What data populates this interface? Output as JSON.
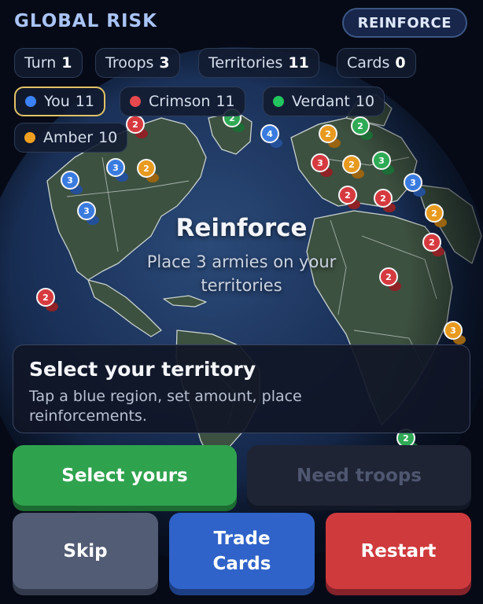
{
  "header": {
    "title": "GLOBAL RISK",
    "phase_button": "REINFORCE"
  },
  "stats": [
    {
      "label": "Turn",
      "value": "1"
    },
    {
      "label": "Troops",
      "value": "3"
    },
    {
      "label": "Territories",
      "value": "11"
    },
    {
      "label": "Cards",
      "value": "0"
    }
  ],
  "players": [
    {
      "name": "You",
      "count": "11",
      "color": "#3b82f6",
      "active": true
    },
    {
      "name": "Crimson",
      "count": "11",
      "color": "#e5484d",
      "active": false
    },
    {
      "name": "Verdant",
      "count": "10",
      "color": "#22c55e",
      "active": false
    },
    {
      "name": "Amber",
      "count": "10",
      "color": "#f0a020",
      "active": false
    }
  ],
  "overlay": {
    "title": "Reinforce",
    "subtitle_line1": "Place 3 armies on your",
    "subtitle_line2": "territories"
  },
  "info": {
    "title": "Select your territory",
    "line1": "Tap a blue region, set amount, place",
    "line2": "reinforcements."
  },
  "buttons": {
    "select": "Select yours",
    "need": "Need troops",
    "skip": "Skip",
    "trade_line1": "Trade",
    "trade_line2": "Cards",
    "restart": "Restart"
  },
  "markers": [
    {
      "owner": "red",
      "label": "2"
    },
    {
      "owner": "green",
      "label": "2"
    },
    {
      "owner": "blue",
      "label": "4"
    },
    {
      "owner": "amber",
      "label": "2"
    },
    {
      "owner": "green",
      "label": "2"
    },
    {
      "owner": "blue",
      "label": "3"
    },
    {
      "owner": "amber",
      "label": "2"
    },
    {
      "owner": "blue",
      "label": "3"
    },
    {
      "owner": "red",
      "label": "3"
    },
    {
      "owner": "amber",
      "label": "2"
    },
    {
      "owner": "green",
      "label": "3"
    },
    {
      "owner": "blue",
      "label": "3"
    },
    {
      "owner": "red",
      "label": "2"
    },
    {
      "owner": "red",
      "label": "2"
    },
    {
      "owner": "amber",
      "label": "2"
    },
    {
      "owner": "red",
      "label": "2"
    },
    {
      "owner": "red",
      "label": "2"
    },
    {
      "owner": "red",
      "label": "2"
    },
    {
      "owner": "amber",
      "label": "3"
    },
    {
      "owner": "blue",
      "label": "3"
    },
    {
      "owner": "green",
      "label": "2"
    }
  ]
}
